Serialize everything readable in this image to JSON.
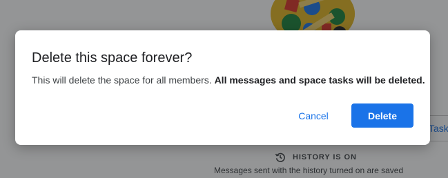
{
  "background": {
    "tasks_chip_label": "Tasks",
    "history_label": "HISTORY IS ON",
    "history_description": "Messages sent with the history turned on are saved"
  },
  "dialog": {
    "title": "Delete this space forever?",
    "body_regular": "This will delete the space for all members. ",
    "body_bold": "All messages and space tasks will be deleted.",
    "cancel_label": "Cancel",
    "delete_label": "Delete"
  },
  "colors": {
    "accent": "#1a73e8",
    "scrim": "#202124",
    "avatar_background": "#e3b51f"
  },
  "icons": {
    "history": "history-clock-icon",
    "space": "space-avatar-icon"
  }
}
